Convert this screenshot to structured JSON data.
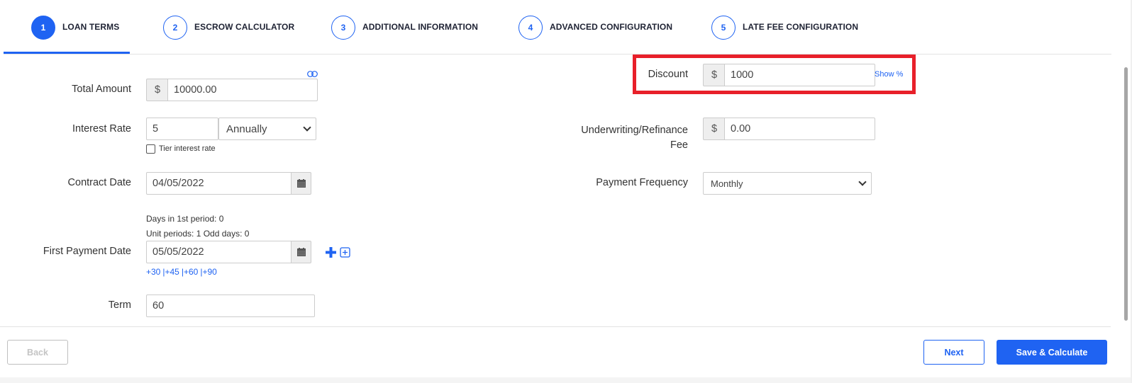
{
  "stepper": {
    "steps": [
      {
        "number": "1",
        "label": "LOAN TERMS",
        "active": true
      },
      {
        "number": "2",
        "label": "ESCROW CALCULATOR",
        "active": false
      },
      {
        "number": "3",
        "label": "ADDITIONAL INFORMATION",
        "active": false
      },
      {
        "number": "4",
        "label": "ADVANCED CONFIGURATION",
        "active": false
      },
      {
        "number": "5",
        "label": "LATE FEE CONFIGURATION",
        "active": false
      }
    ]
  },
  "form": {
    "total_amount": {
      "label": "Total Amount",
      "currency_symbol": "$",
      "value": "10000.00",
      "toggle_icon": "toggle-icon"
    },
    "interest_rate": {
      "label": "Interest Rate",
      "value": "5",
      "period_selected": "Annually",
      "tier_checkbox_label": "Tier interest rate",
      "tier_checked": false
    },
    "contract_date": {
      "label": "Contract Date",
      "value": "04/05/2022",
      "icon": "calendar-icon"
    },
    "period_info": {
      "days_in_first_period": "Days in 1st period: 0",
      "unit_periods": "Unit periods: 1 Odd days: 0"
    },
    "first_payment_date": {
      "label": "First Payment Date",
      "value": "05/05/2022",
      "icon": "calendar-icon",
      "quick_links": [
        "+30",
        "|+45",
        "|+60",
        "|+90"
      ]
    },
    "term": {
      "label": "Term",
      "value": "60"
    },
    "discount": {
      "label": "Discount",
      "currency_symbol": "$",
      "value": "1000",
      "show_percent_link": "Show %"
    },
    "underwriting_fee": {
      "label_line1": "Underwriting/Refinance",
      "label_line2": "Fee",
      "currency_symbol": "$",
      "value": "0.00"
    },
    "payment_frequency": {
      "label": "Payment Frequency",
      "selected": "Monthly"
    }
  },
  "footer": {
    "back_label": "Back",
    "next_label": "Next",
    "save_label": "Save & Calculate"
  },
  "colors": {
    "accent": "#1f63f2",
    "highlight": "#e8202a"
  }
}
